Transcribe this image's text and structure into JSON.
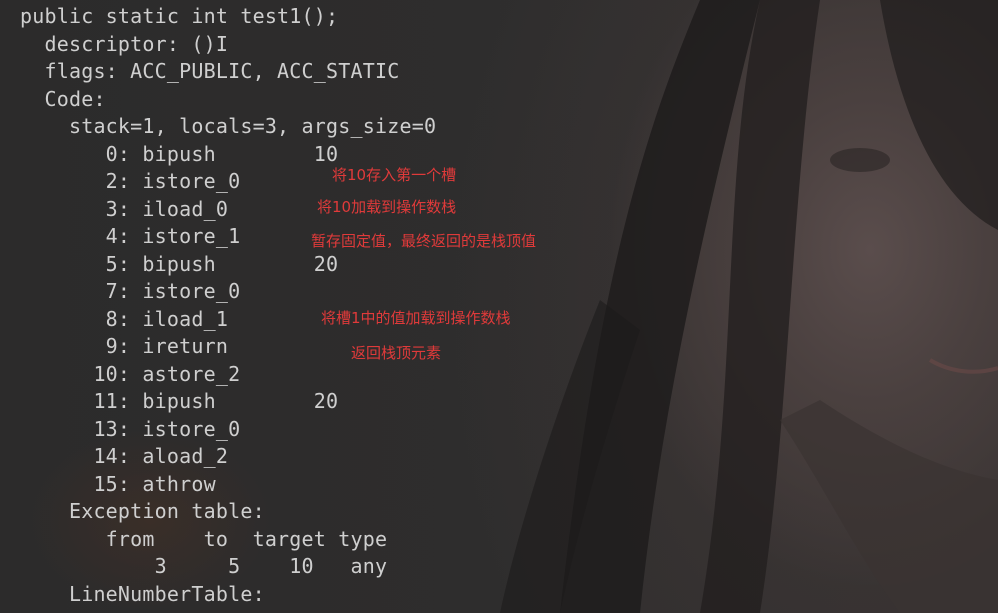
{
  "code_lines": [
    "public static int test1();",
    "  descriptor: ()I",
    "  flags: ACC_PUBLIC, ACC_STATIC",
    "  Code:",
    "    stack=1, locals=3, args_size=0",
    "       0: bipush        10",
    "       2: istore_0",
    "       3: iload_0",
    "       4: istore_1",
    "       5: bipush        20",
    "       7: istore_0",
    "       8: iload_1",
    "       9: ireturn",
    "      10: astore_2",
    "      11: bipush        20",
    "      13: istore_0",
    "      14: aload_2",
    "      15: athrow",
    "    Exception table:",
    "       from    to  target type",
    "           3     5    10   any",
    "    LineNumberTable:"
  ],
  "annotations": [
    "将10存入第一个槽",
    "将10加载到操作数栈",
    "暂存固定值，最终返回的是栈顶值",
    "将槽1中的值加载到操作数栈",
    "返回栈顶元素"
  ],
  "colors": {
    "code_text": "#cfcfcf",
    "annotation_text": "#e03a3a",
    "background": "#2b2b2b"
  }
}
